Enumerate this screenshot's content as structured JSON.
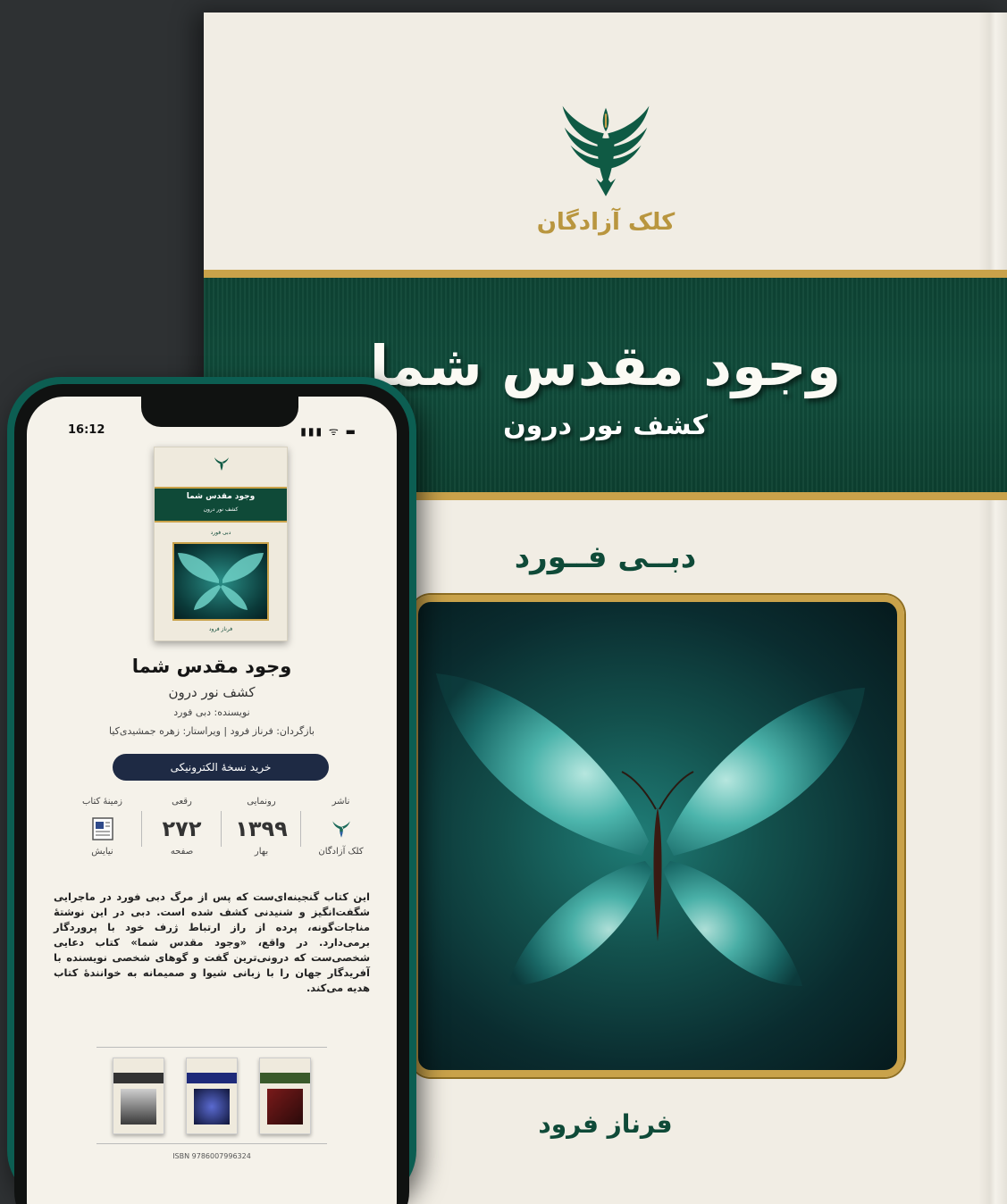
{
  "book": {
    "publisher": "کلک آزادگان",
    "title": "وجود مقدس شما",
    "subtitle": "کشف نور درون",
    "author": "دبــی فــورد",
    "translator": "فرناز فرود"
  },
  "phone": {
    "status_time": "16:12",
    "status_icons": "▮▮▮ ᯤ ▬",
    "title": "وجود مقدس شما",
    "subtitle": "کشف نور درون",
    "author_line": "نویسنده: دبی فورد",
    "credits_line": "بازگردان: فرناز فرود | ویراستار: زهره جمشیدی‌کیا",
    "buy_label": "خرید نسخهٔ الکترونیکی",
    "stats": [
      {
        "label": "ناشر",
        "value": "",
        "caption": "کلک آزادگان"
      },
      {
        "label": "رونمایی",
        "value": "۱۳۹۹",
        "caption": "بهار"
      },
      {
        "label": "رقعی",
        "value": "۲۷۲",
        "caption": "صفحه"
      },
      {
        "label": "زمینهٔ کتاب",
        "value": "",
        "caption": "نیایش"
      }
    ],
    "description": "این کتاب گنجینه‌ای‌ست که پس از مرگ دبی فورد در ماجرایی شگفت‌انگیز و شنیدنی کشف شده است. دبی در این نوشتهٔ مناجات‌گونه، پرده از راز ارتباط ژرف خود با پروردگار برمی‌دارد. در واقع، «وجود مقدس شما» کتاب دعایی شخصی‌ست که درونی‌ترین گفت و گوهای شخصی نویسنده با آفریدگار جهان را با زبانی شیوا و صمیمانه به خوانندهٔ کتاب هدیه می‌کند.",
    "isbn": "ISBN 9786007996324",
    "mini_cover": {
      "title": "وجود مقدس شما",
      "subtitle": "کشف نور درون",
      "author": "دبی فورد",
      "translator": "فرناز فرود"
    }
  },
  "colors": {
    "background": "#2e3133",
    "cover_paper": "#f1ede4",
    "band_green": "#0f4a38",
    "gold": "#c9a24a",
    "phone_frame": "#0c5e52",
    "button": "#1e2a44"
  }
}
